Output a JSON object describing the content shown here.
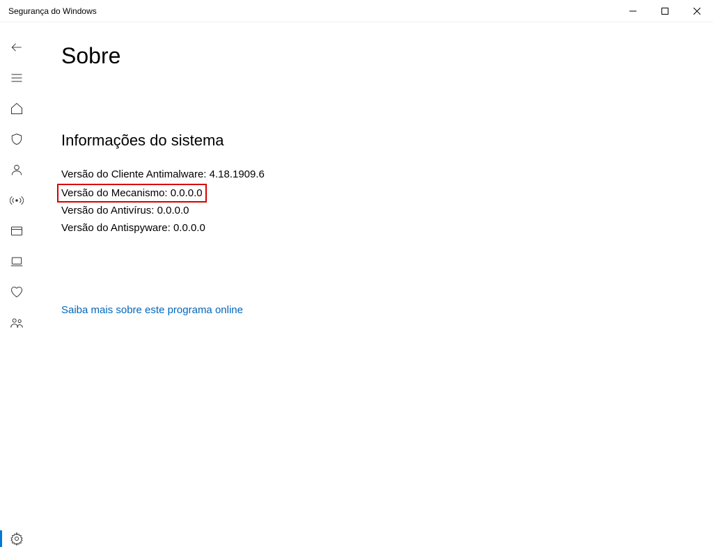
{
  "window": {
    "title": "Segurança do Windows"
  },
  "page": {
    "title": "Sobre",
    "section_title": "Informações do sistema",
    "info": {
      "antimalware_label": "Versão do Cliente Antimalware:",
      "antimalware_value": "4.18.1909.6",
      "engine_label": "Versão do Mecanismo:",
      "engine_value": "0.0.0.0",
      "antivirus_label": "Versão do Antivírus:",
      "antivirus_value": "0.0.0.0",
      "antispyware_label": "Versão do Antispyware:",
      "antispyware_value": "0.0.0.0"
    },
    "link_label": "Saiba mais sobre este programa online"
  },
  "icons": {
    "back": "back-arrow-icon",
    "menu": "hamburger-icon",
    "home": "home-icon",
    "shield": "shield-icon",
    "user": "user-icon",
    "wifi": "broadcast-icon",
    "browser": "browser-icon",
    "laptop": "laptop-icon",
    "heart": "heart-icon",
    "family": "family-icon",
    "settings": "gear-icon",
    "minimize": "minimize-icon",
    "maximize": "maximize-icon",
    "close": "close-icon"
  }
}
